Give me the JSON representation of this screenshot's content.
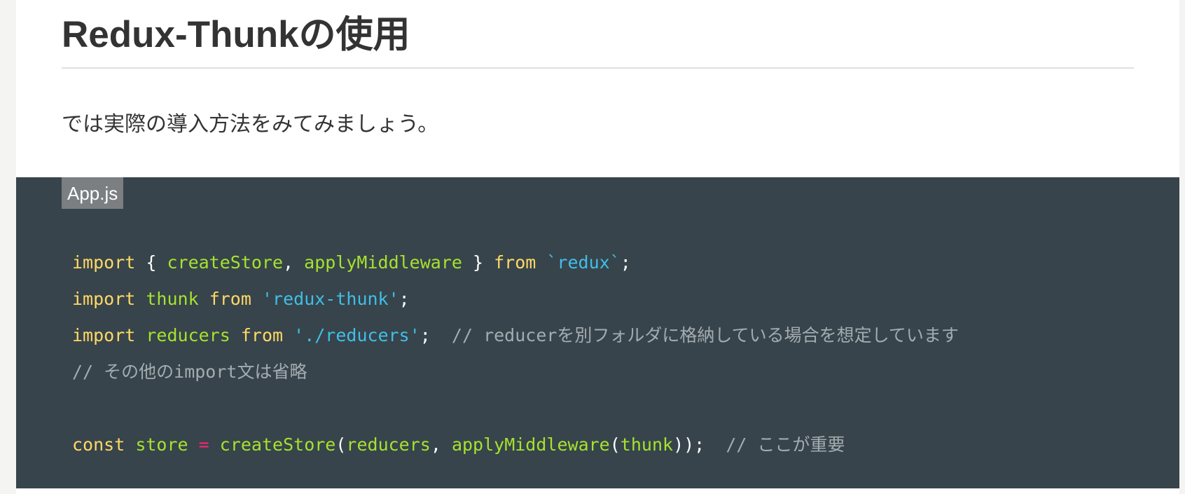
{
  "article": {
    "heading": "Redux-Thunkの使用",
    "intro": "では実際の導入方法をみてみましょう。"
  },
  "code_block": {
    "filename": "App.js",
    "lines": [
      [
        {
          "kind": "kw",
          "text": "import"
        },
        {
          "kind": "pn",
          "text": " { "
        },
        {
          "kind": "fn",
          "text": "createStore"
        },
        {
          "kind": "pn",
          "text": ", "
        },
        {
          "kind": "fn",
          "text": "applyMiddleware"
        },
        {
          "kind": "pn",
          "text": " } "
        },
        {
          "kind": "kw",
          "text": "from"
        },
        {
          "kind": "pn",
          "text": " "
        },
        {
          "kind": "str",
          "text": "`redux`"
        },
        {
          "kind": "pn",
          "text": ";"
        }
      ],
      [
        {
          "kind": "kw",
          "text": "import"
        },
        {
          "kind": "pn",
          "text": " "
        },
        {
          "kind": "fn",
          "text": "thunk"
        },
        {
          "kind": "pn",
          "text": " "
        },
        {
          "kind": "kw",
          "text": "from"
        },
        {
          "kind": "pn",
          "text": " "
        },
        {
          "kind": "str",
          "text": "'redux-thunk'"
        },
        {
          "kind": "pn",
          "text": ";"
        }
      ],
      [
        {
          "kind": "kw",
          "text": "import"
        },
        {
          "kind": "pn",
          "text": " "
        },
        {
          "kind": "fn",
          "text": "reducers"
        },
        {
          "kind": "pn",
          "text": " "
        },
        {
          "kind": "kw",
          "text": "from"
        },
        {
          "kind": "pn",
          "text": " "
        },
        {
          "kind": "str",
          "text": "'./reducers'"
        },
        {
          "kind": "pn",
          "text": ";  "
        },
        {
          "kind": "cm",
          "text": "// reducerを別フォルダに格納している場合を想定しています"
        }
      ],
      [
        {
          "kind": "cm",
          "text": "// その他のimport文は省略"
        }
      ],
      [],
      [
        {
          "kind": "kw",
          "text": "const"
        },
        {
          "kind": "pn",
          "text": " "
        },
        {
          "kind": "fn",
          "text": "store"
        },
        {
          "kind": "pn",
          "text": " "
        },
        {
          "kind": "op",
          "text": "="
        },
        {
          "kind": "pn",
          "text": " "
        },
        {
          "kind": "fn",
          "text": "createStore"
        },
        {
          "kind": "pn",
          "text": "("
        },
        {
          "kind": "fn",
          "text": "reducers"
        },
        {
          "kind": "pn",
          "text": ", "
        },
        {
          "kind": "fn",
          "text": "applyMiddleware"
        },
        {
          "kind": "pn",
          "text": "("
        },
        {
          "kind": "fn",
          "text": "thunk"
        },
        {
          "kind": "pn",
          "text": "));  "
        },
        {
          "kind": "cm",
          "text": "// ここが重要"
        }
      ]
    ]
  },
  "colors": {
    "code_background": "#37444b",
    "keyword": "#ffd866",
    "identifier": "#a6e22e",
    "string": "#3fbfe8",
    "comment": "#a3acb0",
    "operator": "#f92672",
    "file_tab": "#7b7f82",
    "heading_text": "#333333"
  }
}
